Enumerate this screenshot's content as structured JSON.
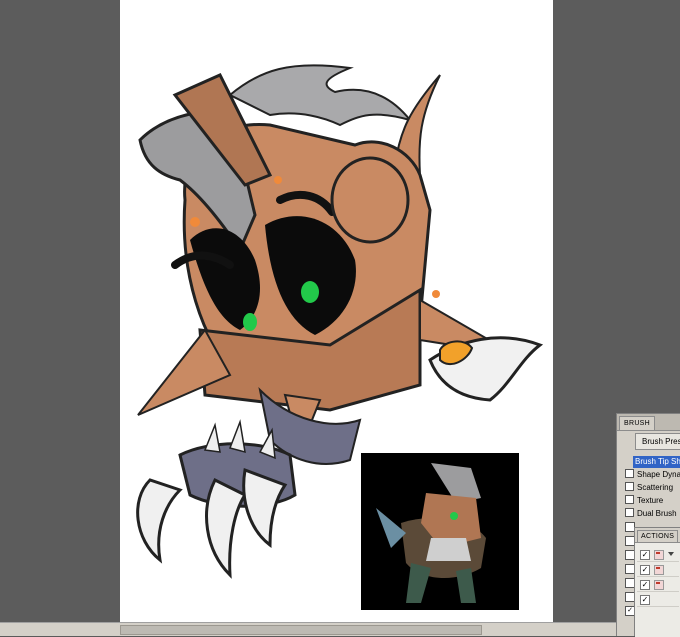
{
  "app": {
    "workspace_bg": "#5c5c5c",
    "canvas_bg": "#ffffff"
  },
  "brush_panel": {
    "tab_label": "BRUSH",
    "presets_button": "Brush Preset",
    "options": [
      {
        "label": "Brush Tip Sha",
        "selected": true,
        "checkbox": false
      },
      {
        "label": "Shape Dynamic",
        "selected": false,
        "checkbox": true
      },
      {
        "label": "Scattering",
        "selected": false,
        "checkbox": true
      },
      {
        "label": "Texture",
        "selected": false,
        "checkbox": true
      },
      {
        "label": "Dual Brush",
        "selected": false,
        "checkbox": true
      }
    ],
    "accent": "#3164c6"
  },
  "actions_panel": {
    "tab_label": "ACTIONS"
  },
  "artwork": {
    "subject": "armored-beast-head",
    "thumbnail_subject": "armored-creature-full-body",
    "colors": {
      "armor": "#c98a63",
      "armor_dark": "#8d5a3b",
      "hair": "#a8a8a8",
      "eye": "#22c94a",
      "claw": "#eeeeee",
      "paw": "#6e6f88",
      "gold": "#f2a12a"
    }
  }
}
